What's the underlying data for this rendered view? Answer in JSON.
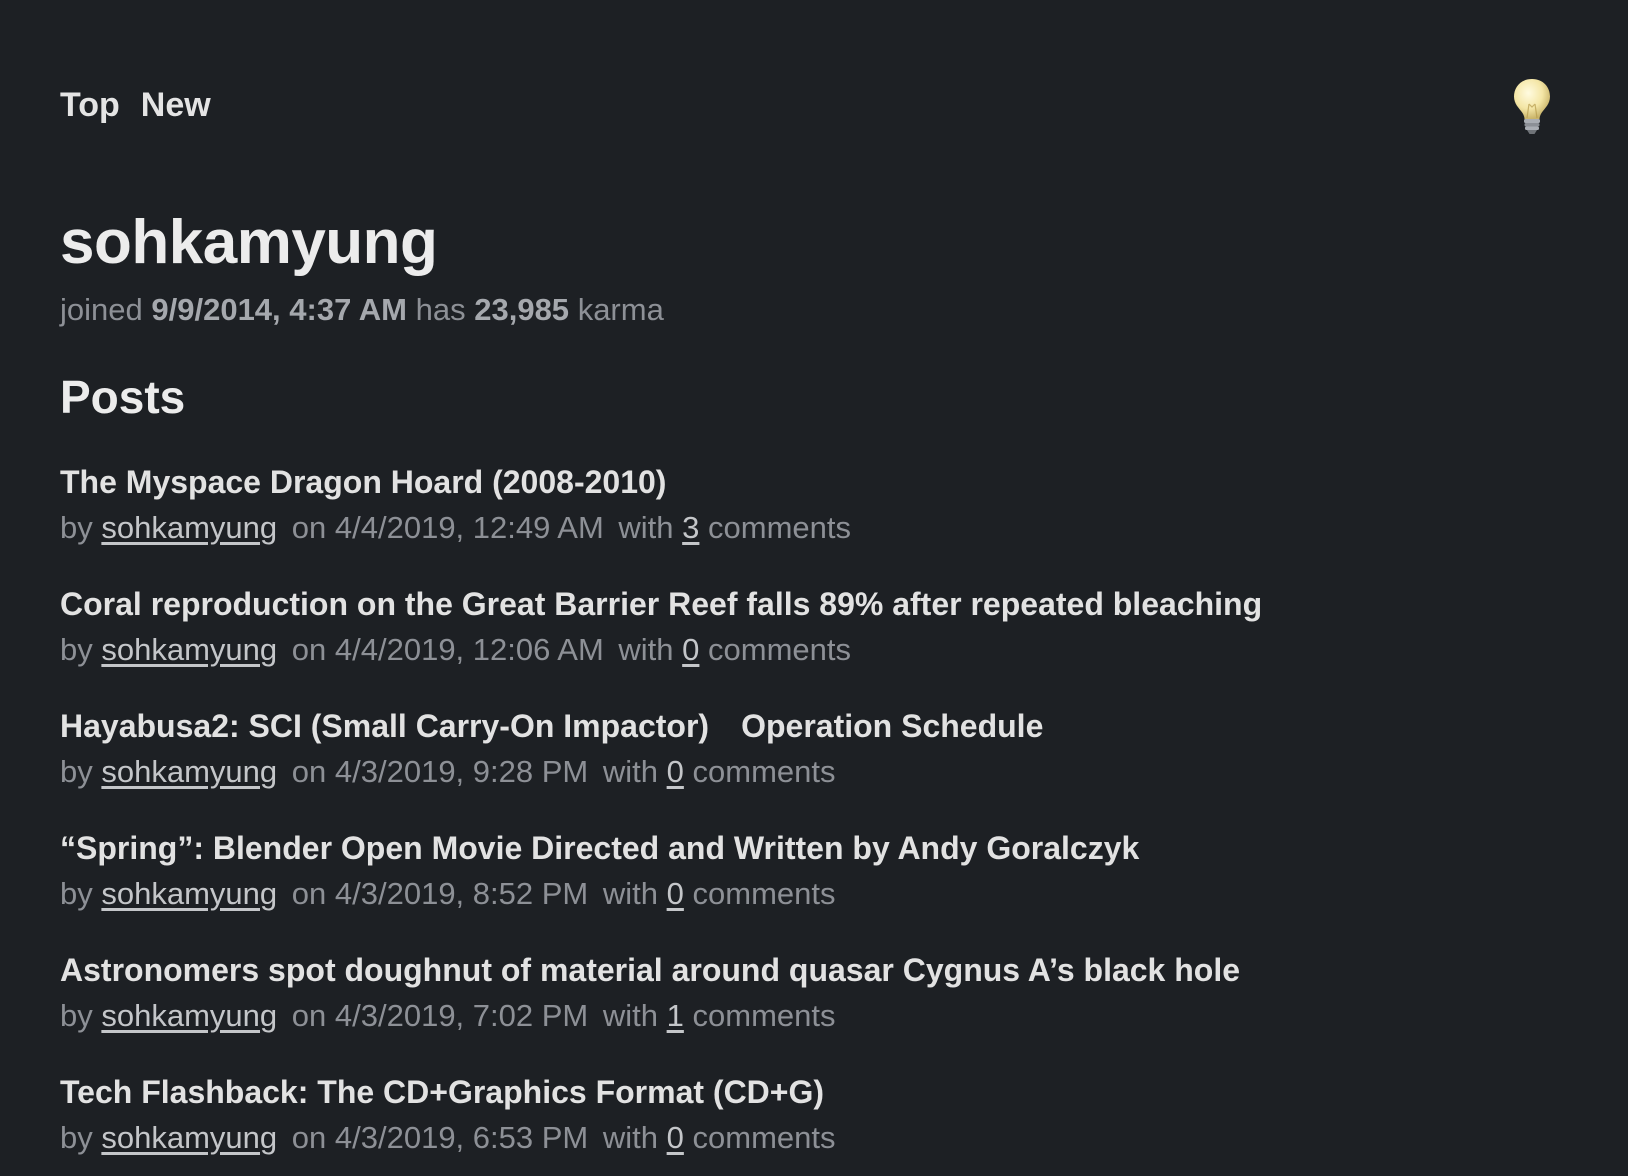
{
  "nav": {
    "top_label": "Top",
    "new_label": "New",
    "theme_icon": "lightbulb-icon"
  },
  "profile": {
    "username": "sohkamyung",
    "joined_prefix": "joined",
    "joined_date": "9/9/2014, 4:37 AM",
    "has_label": "has",
    "karma": "23,985",
    "karma_label": "karma"
  },
  "posts_heading": "Posts",
  "meta_labels": {
    "by": "by",
    "on": "on",
    "with": "with",
    "comments": "comments"
  },
  "posts": [
    {
      "title": "The Myspace Dragon Hoard (2008-2010)",
      "author": "sohkamyung",
      "date": "4/4/2019, 12:49 AM",
      "comments": "3"
    },
    {
      "title": "Coral reproduction on the Great Barrier Reef falls 89% after repeated bleaching",
      "author": "sohkamyung",
      "date": "4/4/2019, 12:06 AM",
      "comments": "0"
    },
    {
      "title": "Hayabusa2: SCI (Small Carry-On Impactor) Operation Schedule",
      "author": "sohkamyung",
      "date": "4/3/2019, 9:28 PM",
      "comments": "0"
    },
    {
      "title": "“Spring”: Blender Open Movie Directed and Written by Andy Goralczyk",
      "author": "sohkamyung",
      "date": "4/3/2019, 8:52 PM",
      "comments": "0"
    },
    {
      "title": "Astronomers spot doughnut of material around quasar Cygnus A’s black hole",
      "author": "sohkamyung",
      "date": "4/3/2019, 7:02 PM",
      "comments": "1"
    },
    {
      "title": "Tech Flashback: The CD+Graphics Format (CD+G)",
      "author": "sohkamyung",
      "date": "4/3/2019, 6:53 PM",
      "comments": "0"
    }
  ]
}
